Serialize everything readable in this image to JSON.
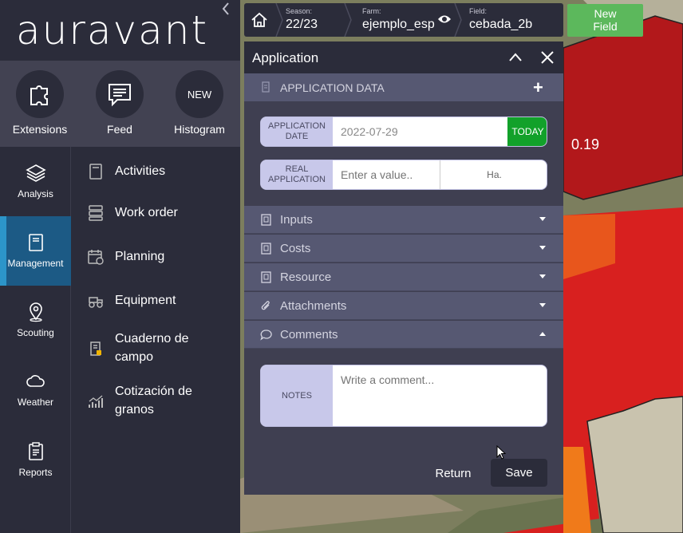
{
  "brand": {
    "logo_text": "auravant"
  },
  "shortcuts": [
    {
      "label": "Extensions",
      "icon": "puzzle-icon"
    },
    {
      "label": "Feed",
      "icon": "chat-icon"
    },
    {
      "label": "Histogram",
      "badge": "NEW"
    }
  ],
  "rail": [
    {
      "label": "Analysis",
      "icon": "layers-icon",
      "active": false
    },
    {
      "label": "Management",
      "icon": "notebook-icon",
      "active": true
    },
    {
      "label": "Scouting",
      "icon": "location-pin-icon",
      "active": false
    },
    {
      "label": "Weather",
      "icon": "cloud-icon",
      "active": false
    },
    {
      "label": "Reports",
      "icon": "clipboard-icon",
      "active": false
    }
  ],
  "submenu": [
    {
      "label": "Activities",
      "icon": "notebook-icon"
    },
    {
      "label": "Work order",
      "icon": "server-list-icon"
    },
    {
      "label": "Planning",
      "icon": "calendar-icon"
    },
    {
      "label": "Equipment",
      "icon": "tractor-icon"
    },
    {
      "label_line1": "Cuaderno de",
      "label_line2": "campo",
      "icon": "field-book-icon"
    },
    {
      "label_line1": "Cotización de",
      "label_line2": "granos",
      "icon": "trend-chart-icon"
    }
  ],
  "topbar": {
    "season_caption": "Season:",
    "season": "22/23",
    "farm_caption": "Farm:",
    "farm": "ejemplo_esp",
    "field_caption": "Field:",
    "field": "cebada_2b",
    "new_field_line1": "New",
    "new_field_line2": "Field"
  },
  "map": {
    "value_label": "0.19"
  },
  "panel": {
    "title": "Application",
    "app_data_label": "APPLICATION DATA",
    "date_label_line1": "APPLICATION",
    "date_label_line2": "DATE",
    "date_value": "2022-07-29",
    "today_label": "TODAY",
    "real_label_line1": "REAL",
    "real_label_line2": "APPLICATION",
    "real_placeholder": "Enter a value..",
    "unit": "Ha.",
    "sections": [
      {
        "label": "Inputs",
        "icon": "document-icon",
        "expanded": false
      },
      {
        "label": "Costs",
        "icon": "document-icon",
        "expanded": false
      },
      {
        "label": "Resource",
        "icon": "document-icon",
        "expanded": false
      },
      {
        "label": "Attachments",
        "icon": "paperclip-icon",
        "expanded": false
      },
      {
        "label": "Comments",
        "icon": "speech-bubble-icon",
        "expanded": true
      }
    ],
    "notes_label": "NOTES",
    "comment_placeholder": "Write a comment...",
    "return_label": "Return",
    "save_label": "Save"
  },
  "colors": {
    "accent": "#2c95c9",
    "today": "#12a12a",
    "new_field": "#5cb85c",
    "sidebar": "#2b2c3a",
    "section": "#565872"
  }
}
